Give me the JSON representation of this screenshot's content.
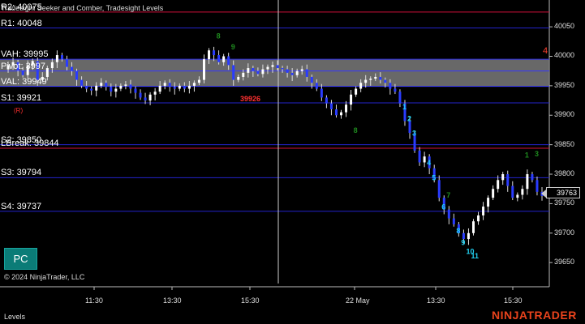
{
  "title": "Tradesight Seeker and Comber, Tradesight Levels",
  "levels": [
    {
      "name": "R2",
      "label": "R2: 40075",
      "price": 40075,
      "color": "#d0103a",
      "labelColor": "#ffffff"
    },
    {
      "name": "R1",
      "label": "R1: 40048",
      "price": 40048,
      "color": "#2323cc",
      "labelColor": "#ffffff"
    },
    {
      "name": "VAH",
      "label": "VAH: 39995",
      "price": 39995,
      "color": "#2a2ae0",
      "labelColor": "#ffffff"
    },
    {
      "name": "Pivot",
      "label": "Pivot: 3997",
      "price": 39975,
      "color": "#3535ff",
      "labelColor": "#ffffff"
    },
    {
      "name": "VAL",
      "label": "VAL: 39949",
      "price": 39949,
      "color": "#3535ff",
      "labelColor": "#ffffff"
    },
    {
      "name": "S1",
      "label": "S1: 39921",
      "price": 39921,
      "color": "#2323cc",
      "labelColor": "#ffffff"
    },
    {
      "name": "S2",
      "label": "S2: 39850",
      "price": 39850,
      "color": "#2323cc",
      "labelColor": "#ffffff"
    },
    {
      "name": "LBreak",
      "label": "LBreak: 39844",
      "price": 39844,
      "color": "#d0103a",
      "labelColor": "#ffffff"
    },
    {
      "name": "S3",
      "label": "S3: 39794",
      "price": 39794,
      "color": "#2323cc",
      "labelColor": "#ffffff"
    },
    {
      "name": "S4",
      "label": "S4: 39737",
      "price": 39737,
      "color": "#2323cc",
      "labelColor": "#ffffff"
    }
  ],
  "price_axis": {
    "min": 39620,
    "max": 40090,
    "ticks": [
      40050,
      40000,
      39950,
      39900,
      39850,
      39800,
      39750,
      39700,
      39650
    ]
  },
  "time_axis": [
    "11:30",
    "13:30",
    "15:30",
    "22 May",
    "13:30",
    "15:30"
  ],
  "current_price": "39763",
  "marker_right": "4",
  "red_labels": [
    "39926",
    "(R)"
  ],
  "value_area_band": {
    "from": 39949,
    "to": 39995
  },
  "pc_button": "PC",
  "copyright": "© 2024 NinjaTrader, LLC",
  "panel_label": "Levels",
  "brand": "NINJATRADER",
  "colors": {
    "up": "#ffffff",
    "down": "#2a3cff",
    "green": "#1f8a1f",
    "cyan": "#20d0f0",
    "red": "#ff3030",
    "band": "#7a7a7a"
  },
  "chart_data": {
    "type": "candlestick",
    "ylim": [
      39620,
      40090
    ],
    "x_ticks": [
      "11:30",
      "13:30",
      "15:30",
      "22 May",
      "13:30",
      "15:30"
    ],
    "y_ticks": [
      40050,
      40000,
      39950,
      39900,
      39850,
      39800,
      39750,
      39700,
      39650
    ],
    "last": 39763,
    "close_path": [
      39978,
      39985,
      39990,
      39976,
      39968,
      39985,
      39992,
      39960,
      39965,
      39980,
      39990,
      40002,
      39995,
      39982,
      39975,
      39960,
      39950,
      39945,
      39942,
      39950,
      39955,
      39948,
      39940,
      39945,
      39950,
      39952,
      39945,
      39938,
      39930,
      39925,
      39935,
      39940,
      39950,
      39955,
      39948,
      39945,
      39950,
      39945,
      39950,
      39955,
      39960,
      39995,
      40010,
      40002,
      39990,
      40000,
      39985,
      39960,
      39965,
      39972,
      39980,
      39975,
      39970,
      39978,
      39982,
      39985,
      39980,
      39978,
      39972,
      39968,
      39975,
      39978,
      39965,
      39955,
      39945,
      39930,
      39920,
      39910,
      39900,
      39905,
      39918,
      39935,
      39945,
      39955,
      39960,
      39962,
      39965,
      39960,
      39955,
      39945,
      39940,
      39920,
      39890,
      39870,
      39840,
      39820,
      39830,
      39810,
      39790,
      39760,
      39740,
      39725,
      39715,
      39700,
      39690,
      39700,
      39720,
      39730,
      39745,
      39760,
      39775,
      39790,
      39800,
      39780,
      39760,
      39765,
      39775,
      39800,
      39790,
      39770,
      39763
    ],
    "counts": [
      {
        "text": "8",
        "color": "green",
        "price": 40030,
        "idx": 44
      },
      {
        "text": "9",
        "color": "green",
        "price": 40012,
        "idx": 47
      },
      {
        "text": "1",
        "color": "cyan",
        "price": 39910,
        "idx": 82
      },
      {
        "text": "2",
        "color": "cyan",
        "price": 39890,
        "idx": 83
      },
      {
        "text": "3",
        "color": "cyan",
        "price": 39865,
        "idx": 84
      },
      {
        "text": "4",
        "color": "cyan",
        "price": 39815,
        "idx": 87
      },
      {
        "text": "5",
        "color": "cyan",
        "price": 39790,
        "idx": 88
      },
      {
        "text": "6",
        "color": "cyan",
        "price": 39740,
        "idx": 90
      },
      {
        "text": "7",
        "color": "green",
        "price": 39760,
        "idx": 91
      },
      {
        "text": "8",
        "color": "cyan",
        "price": 39700,
        "idx": 93
      },
      {
        "text": "9",
        "color": "cyan",
        "price": 39680,
        "idx": 94
      },
      {
        "text": "10",
        "color": "cyan",
        "price": 39665,
        "idx": 95
      },
      {
        "text": "11",
        "color": "cyan",
        "price": 39657,
        "idx": 96
      },
      {
        "text": "8",
        "color": "green",
        "price": 39870,
        "idx": 72
      },
      {
        "text": "1",
        "color": "green",
        "price": 39828,
        "idx": 107
      },
      {
        "text": "3",
        "color": "green",
        "price": 39830,
        "idx": 109
      }
    ]
  }
}
